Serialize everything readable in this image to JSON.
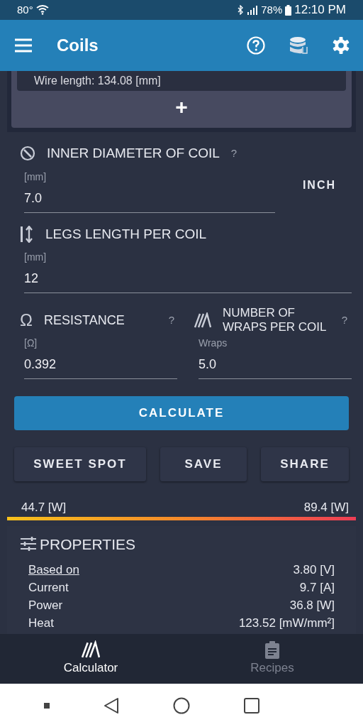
{
  "status_bar": {
    "temperature": "80°",
    "battery": "78%",
    "time": "12:10 PM"
  },
  "app_bar": {
    "title": "Coils"
  },
  "coil_card": {
    "wire_length": "Wire length: 134.08 [mm]",
    "add": "+"
  },
  "inner_diameter": {
    "label": "INNER DIAMETER OF COIL",
    "help": "?",
    "unit": "[mm]",
    "value": "7.0",
    "unit_toggle": "INCH"
  },
  "legs_length": {
    "label": "LEGS LENGTH PER COIL",
    "unit": "[mm]",
    "value": "12"
  },
  "resistance": {
    "icon": "Ω",
    "label": "RESISTANCE",
    "help": "?",
    "unit": "[Ω]",
    "value": "0.392"
  },
  "wraps": {
    "label": "NUMBER OF WRAPS PER COIL",
    "help": "?",
    "unit": "Wraps",
    "value": "5.0"
  },
  "calculate": "CALCULATE",
  "actions": [
    "SWEET SPOT",
    "SAVE",
    "SHARE"
  ],
  "sweet_spot": {
    "min": "44.7 [W]",
    "max": "89.4 [W]"
  },
  "properties": {
    "title": "PROPERTIES",
    "rows": [
      {
        "kind": "link",
        "label": "Based on",
        "value": "3.80 [V]"
      },
      {
        "kind": "plain",
        "label": "Current",
        "value": "9.7 [A]"
      },
      {
        "kind": "plain",
        "label": "Power",
        "value": "36.8 [W]"
      },
      {
        "kind": "plain",
        "label": "Heat",
        "value": "123.52 [mW/mm²]"
      }
    ]
  },
  "bottom_nav": [
    {
      "label": "Calculator",
      "selected": true
    },
    {
      "label": "Recipes",
      "selected": false
    }
  ]
}
